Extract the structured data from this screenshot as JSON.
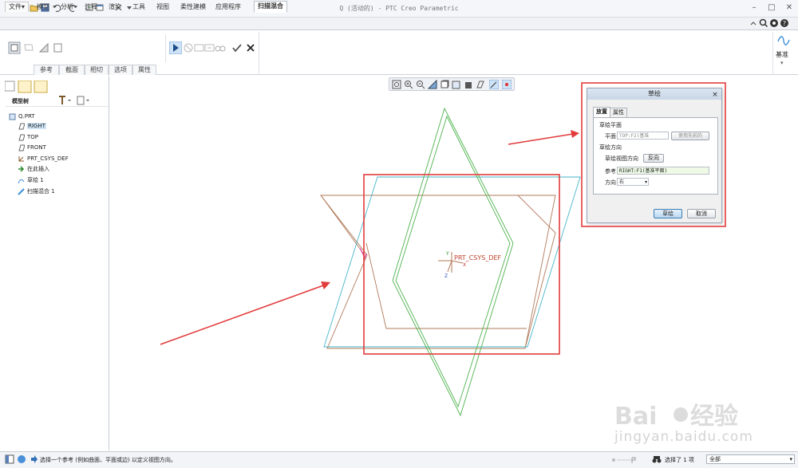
{
  "window": {
    "title": "Q (活动的) - PTC Creo Parametric"
  },
  "tabs": [
    {
      "label": "文件▾"
    },
    {
      "label": "模型"
    },
    {
      "label": "分析"
    },
    {
      "label": "注释"
    },
    {
      "label": "渲染"
    },
    {
      "label": "工具"
    },
    {
      "label": "视图"
    },
    {
      "label": "柔性建模"
    },
    {
      "label": "应用程序"
    },
    {
      "label": "扫描混合"
    }
  ],
  "ribbon": {
    "subtabs": [
      "参考",
      "截面",
      "相切",
      "选项",
      "属性"
    ],
    "datum_label": "基准"
  },
  "model_tree": {
    "title": "模型树",
    "items": [
      {
        "label": "Q.PRT",
        "icon": "part-icon"
      },
      {
        "label": "RIGHT",
        "icon": "datum-plane-icon",
        "selected": true
      },
      {
        "label": "TOP",
        "icon": "datum-plane-icon"
      },
      {
        "label": "FRONT",
        "icon": "datum-plane-icon"
      },
      {
        "label": "PRT_CSYS_DEF",
        "icon": "csys-icon"
      },
      {
        "label": "在此插入",
        "icon": "insert-arrow-icon"
      },
      {
        "label": "草绘 1",
        "icon": "sketch-icon"
      },
      {
        "label": "扫描混合 1",
        "icon": "sweep-blend-icon"
      }
    ]
  },
  "canvas": {
    "csys_label": "PRT_CSYS_DEF",
    "axis_x": "X",
    "axis_y": "Y",
    "axis_z": "Z"
  },
  "dialog": {
    "title": "草绘",
    "close": "×",
    "tabs": [
      "放置",
      "属性"
    ],
    "section_plane": "草绘平面",
    "plane_label": "平面",
    "plane_value": "TOP:F2(基准",
    "use_previous": "使用先前的",
    "section_orientation": "草绘方向",
    "view_direction_label": "草绘视图方向",
    "flip_button": "反向",
    "reference_label": "参考",
    "reference_value": "RIGHT:F1(基准平面)",
    "direction_label": "方向",
    "direction_value": "右",
    "ok_button": "草绘",
    "cancel_button": "取消"
  },
  "statusbar": {
    "message": "选择一个参考 (例如曲面、平面或边) 以定义视图方向。",
    "selected": "选择了 1 项",
    "filter": "全部"
  },
  "watermark": {
    "text": "jingyan.baidu.com"
  },
  "colors": {
    "accent": "#2f6fb5",
    "annotation_red": "#e23b3b",
    "sketch_brown": "#b07a5a",
    "sketch_green": "#4fb34f",
    "sketch_cyan": "#46b6c9"
  }
}
